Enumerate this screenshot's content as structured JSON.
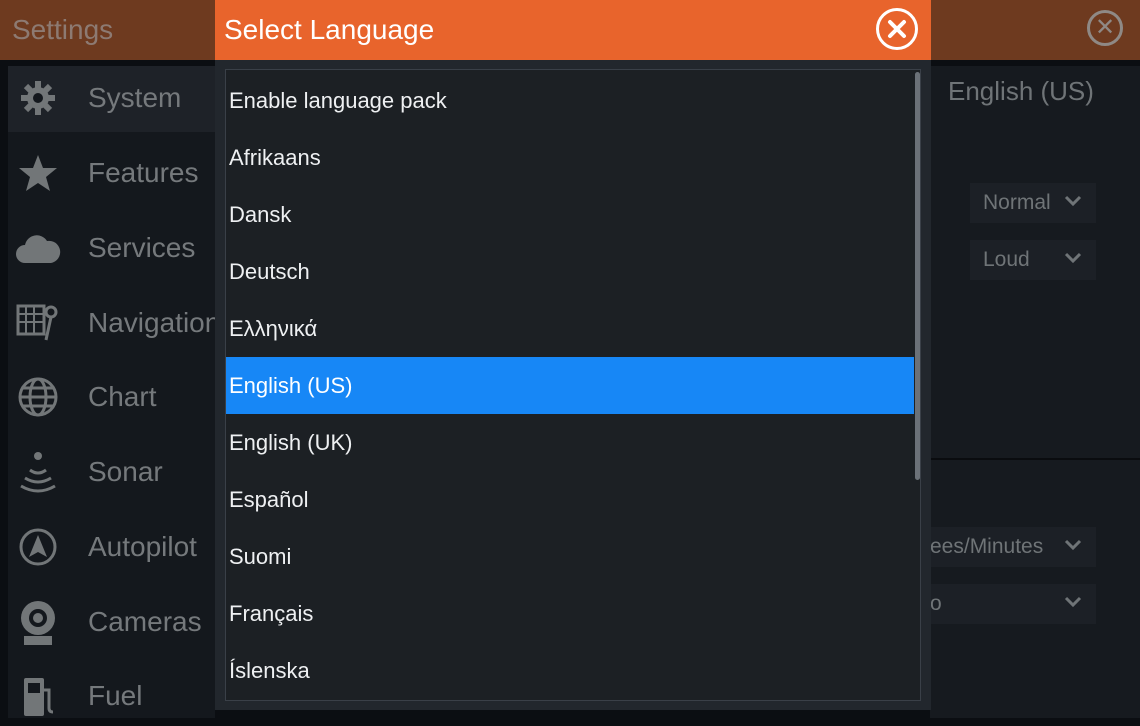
{
  "background": {
    "title": "Settings",
    "nav": [
      {
        "label": "System",
        "icon": "gear-icon"
      },
      {
        "label": "Features",
        "icon": "star-icon"
      },
      {
        "label": "Services",
        "icon": "cloud-icon"
      },
      {
        "label": "Navigation",
        "icon": "navigation-icon"
      },
      {
        "label": "Chart",
        "icon": "globe-icon"
      },
      {
        "label": "Sonar",
        "icon": "sonar-icon"
      },
      {
        "label": "Autopilot",
        "icon": "autopilot-icon"
      },
      {
        "label": "Cameras",
        "icon": "camera-icon"
      },
      {
        "label": "Fuel",
        "icon": "fuel-pump-icon"
      }
    ],
    "language_value": "English (US)",
    "dropdowns": [
      "Normal",
      "Loud",
      "ees/Minutes",
      "o"
    ]
  },
  "dialog": {
    "title": "Select Language",
    "languages": [
      "Enable language pack",
      "Afrikaans",
      "Dansk",
      "Deutsch",
      "Ελληνικά",
      "English (US)",
      "English (UK)",
      "Español",
      "Suomi",
      "Français",
      "Íslenska"
    ],
    "selected": "English (US)",
    "scroll_position": 0.0,
    "visible_fraction": 0.64
  },
  "colors": {
    "accent_orange": "#e8642c",
    "selection_blue": "#1787f6"
  }
}
